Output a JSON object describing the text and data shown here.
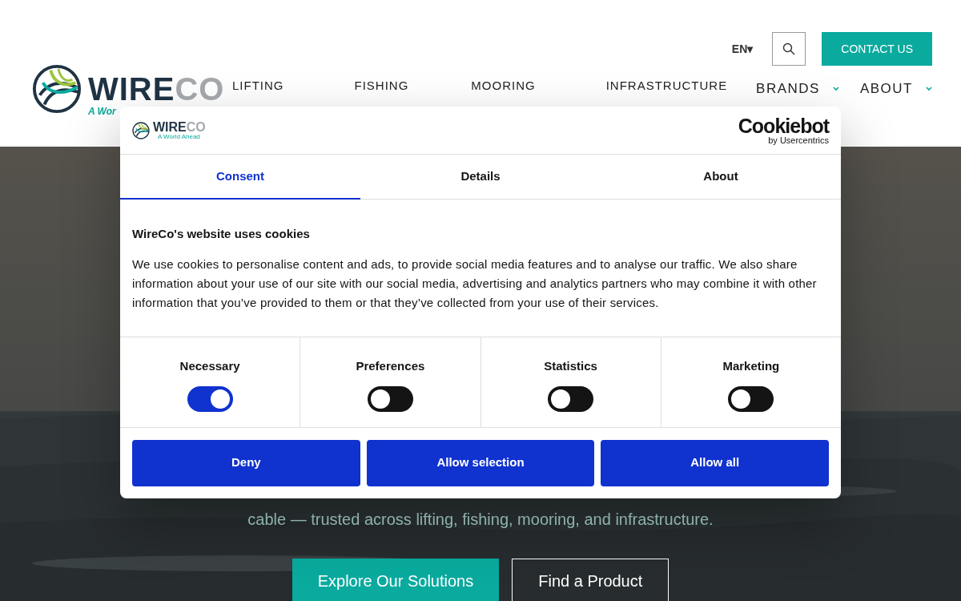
{
  "header": {
    "logo": {
      "word_dark": "WIRE",
      "word_light": "CO",
      "tagline": "A Wor"
    },
    "language": {
      "label": "EN",
      "caret": "▾"
    },
    "contact_button": "CONTACT US",
    "nav": [
      {
        "label": "LIFTING",
        "dropdown": false
      },
      {
        "label": "FISHING",
        "dropdown": false
      },
      {
        "label": "MOORING",
        "dropdown": false
      },
      {
        "label": "INFRASTRUCTURE",
        "dropdown": false
      },
      {
        "label": "BRANDS",
        "dropdown": true
      },
      {
        "label": "ABOUT",
        "dropdown": true
      }
    ]
  },
  "hero": {
    "kind": "picture",
    "subtitle": "cable — trusted across lifting, fishing, mooring, and infrastructure.",
    "buttons": [
      {
        "label": "Explore Our Solutions",
        "kind": "primary"
      },
      {
        "label": "Find a Product",
        "kind": "outline"
      }
    ]
  },
  "cookie_dialog": {
    "logo": {
      "word_dark": "WIRE",
      "word_light": "CO",
      "tagline": "A World Ahead"
    },
    "brand": {
      "name": "Cookiebot",
      "byline": "by Usercentrics"
    },
    "tabs": [
      {
        "label": "Consent",
        "selected": true
      },
      {
        "label": "Details",
        "selected": false
      },
      {
        "label": "About",
        "selected": false
      }
    ],
    "title": "WireCo's website uses cookies",
    "text": "We use cookies to personalise content and ads, to provide social media features and to analyse our traffic. We also share information about your use of our site with our social media, advertising and analytics partners who may combine it with other information that you’ve provided to them or that they’ve collected from your use of their services.",
    "categories": [
      {
        "label": "Necessary",
        "checked": true
      },
      {
        "label": "Preferences",
        "checked": false
      },
      {
        "label": "Statistics",
        "checked": false
      },
      {
        "label": "Marketing",
        "checked": false
      }
    ],
    "buttons": [
      "Deny",
      "Allow selection",
      "Allow all"
    ]
  }
}
